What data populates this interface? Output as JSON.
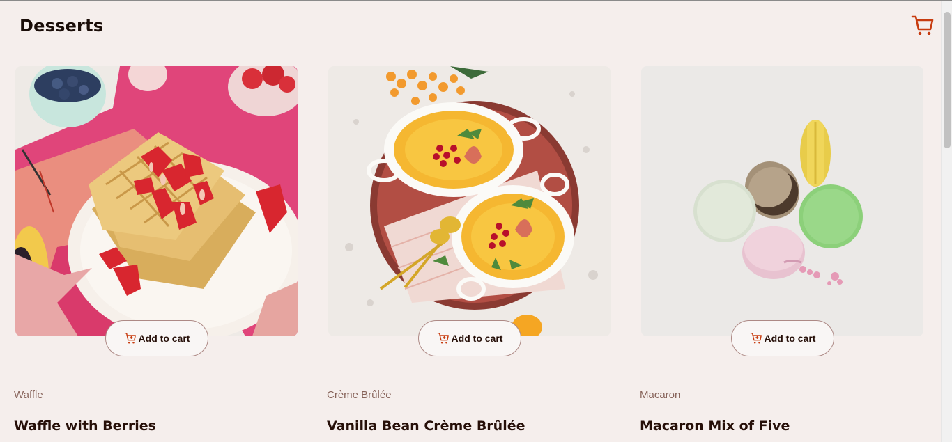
{
  "header": {
    "title": "Desserts"
  },
  "products": [
    {
      "category": "Waffle",
      "name": "Waffle with Berries",
      "button_label": "Add to cart",
      "image_icon": "waffle-image"
    },
    {
      "category": "Crème Brûlée",
      "name": "Vanilla Bean Crème Brûlée",
      "button_label": "Add to cart",
      "image_icon": "creme-brulee-image"
    },
    {
      "category": "Macaron",
      "name": "Macaron Mix of Five",
      "button_label": "Add to cart",
      "image_icon": "macaron-image"
    }
  ],
  "colors": {
    "accent": "#c73b0f",
    "background": "#f5eeec",
    "button_border": "#ad8985"
  }
}
